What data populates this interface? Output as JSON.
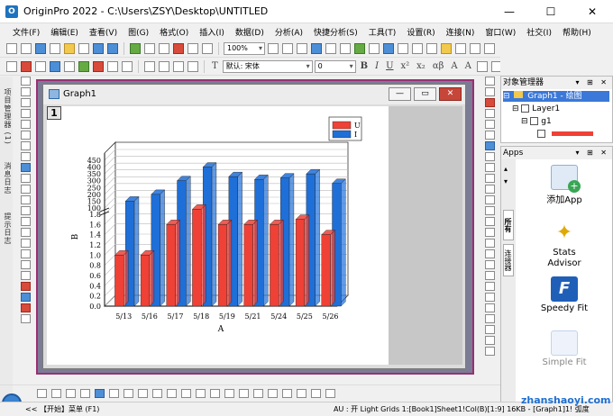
{
  "window": {
    "title": "OriginPro 2022 - C:\\Users\\ZSY\\Desktop\\UNTITLED"
  },
  "menu": [
    "文件(F)",
    "编辑(E)",
    "查看(V)",
    "图(G)",
    "格式(O)",
    "插入(I)",
    "数据(D)",
    "分析(A)",
    "快捷分析(S)",
    "工具(T)",
    "设置(R)",
    "连接(N)",
    "窗口(W)",
    "社交(I)",
    "帮助(H)"
  ],
  "toolbar": {
    "zoom": "100%",
    "font_name": "默认: 宋体",
    "font_size": "0"
  },
  "left_panel": {
    "tab1": "项目管理器 (1)",
    "tab2": "消息日志",
    "tab3": "提示日志"
  },
  "graph_window": {
    "title": "Graph1",
    "layer_number": "1"
  },
  "object_manager": {
    "title": "对象管理器",
    "graph_item": "Graph1 - 绘图",
    "layer_item": "Layer1",
    "group_item": "g1"
  },
  "apps": {
    "title": "Apps",
    "side_tab_all": "所有",
    "side_tab_connectors": "连接器",
    "items": [
      {
        "label": "添加App"
      },
      {
        "label": "Stats Advisor"
      },
      {
        "label": "Speedy Fit"
      },
      {
        "label": "Simple Fit"
      }
    ]
  },
  "status": {
    "start": "<<  【开始】菜单 (F1)",
    "info": "AU : 开  Light Grids  1:[Book1]Sheet1!Col(B)[1:9]  16KB - [Graph1]1!  弧度"
  },
  "watermark": "zhanshaoyi.com",
  "colors": {
    "series_u": "#ef4136",
    "series_i": "#1f6fd8"
  },
  "chart_data": {
    "type": "bar",
    "categories": [
      "5/13",
      "5/16",
      "5/17",
      "5/18",
      "5/19",
      "5/21",
      "5/24",
      "5/25",
      "5/26"
    ],
    "series": [
      {
        "name": "U",
        "values": [
          1.0,
          1.0,
          1.6,
          1.9,
          1.6,
          1.6,
          1.6,
          1.7,
          1.4
        ]
      },
      {
        "name": "I",
        "values": [
          150,
          200,
          300,
          400,
          330,
          310,
          320,
          350,
          280
        ]
      }
    ],
    "xlabel": "A",
    "ylabel": "B",
    "y_lower_ticks": [
      "0.0",
      "0.2",
      "0.4",
      "0.6",
      "0.8",
      "1.0",
      "1.2",
      "1.4",
      "1.6",
      "1.8"
    ],
    "y_upper_ticks": [
      "100",
      "150",
      "200",
      "250",
      "300",
      "350",
      "400",
      "450"
    ],
    "y_break": true,
    "style": "3D grouped columns",
    "legend_position": "top-right"
  }
}
